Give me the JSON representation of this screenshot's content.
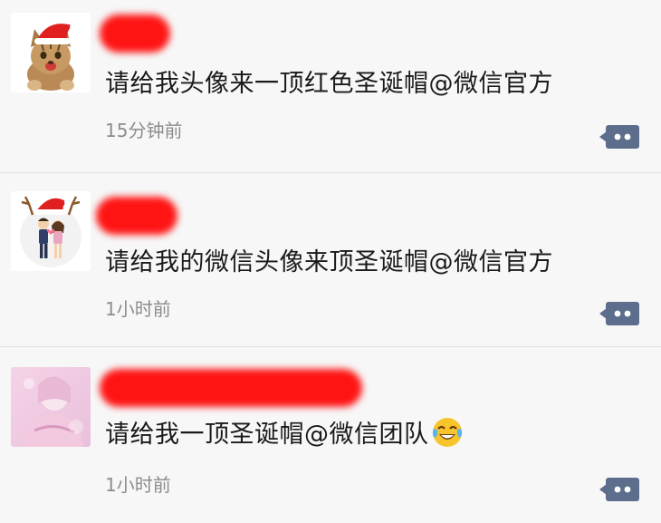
{
  "posts": [
    {
      "text": "请给我头像来一顶红色圣诞帽@微信官方",
      "time": "15分钟前",
      "avatar_icon": "cat-with-santa-hat-icon",
      "emoji_icon": ""
    },
    {
      "text": "请给我的微信头像来顶圣诞帽@微信官方",
      "time": "1小时前",
      "avatar_icon": "couple-cartoon-with-antlers-icon",
      "emoji_icon": ""
    },
    {
      "text": "请给我一顶圣诞帽@微信团队",
      "time": "1小时前",
      "avatar_icon": "pink-photo-avatar-icon",
      "emoji_icon": "crying-laughing-emoji-icon"
    }
  ],
  "comment_icon": "comment-dots-icon",
  "colors": {
    "background": "#f7f7f7",
    "text": "#1a1a1a",
    "time": "#8c8c8c",
    "redaction": "#ff1414",
    "comment_button": "#5d6d8c"
  }
}
